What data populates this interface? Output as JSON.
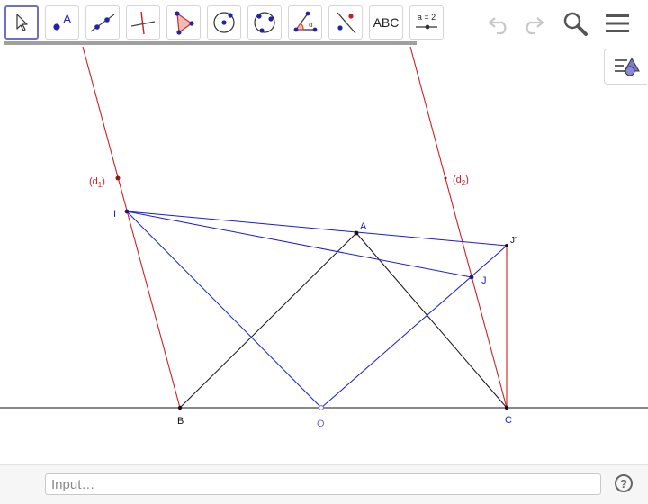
{
  "toolbar": {
    "tools": [
      {
        "name": "move-tool",
        "icon": "cursor-arrow-icon"
      },
      {
        "name": "point-tool",
        "icon": "point-a-icon",
        "label": "A"
      },
      {
        "name": "line-tool",
        "icon": "line-through-points-icon"
      },
      {
        "name": "perpendicular-line-tool",
        "icon": "perpendicular-line-icon"
      },
      {
        "name": "polygon-tool",
        "icon": "triangle-polygon-icon"
      },
      {
        "name": "circle-center-point-tool",
        "icon": "circle-center-icon"
      },
      {
        "name": "circle-three-points-tool",
        "icon": "circle-three-points-icon"
      },
      {
        "name": "angle-tool",
        "icon": "angle-alpha-icon",
        "label": "α"
      },
      {
        "name": "reflect-line-tool",
        "icon": "reflect-line-icon"
      },
      {
        "name": "text-tool",
        "icon": "abc-text-icon",
        "label": "ABC"
      },
      {
        "name": "slider-tool",
        "icon": "slider-icon",
        "label": "a = 2"
      }
    ],
    "undo_icon": "undo-icon",
    "redo_icon": "redo-icon",
    "search_icon": "search-icon",
    "menu_icon": "hamburger-menu-icon"
  },
  "algebra_toggle_icon": "algebra-view-icon",
  "colors": {
    "red": "#d02020",
    "blue": "#1a1ad6",
    "black": "#111111",
    "accent": "#6f6fc8"
  },
  "construction": {
    "labels": {
      "d1": "(d",
      "d1_sub": "1",
      "d1_close": ")",
      "d2": "(d",
      "d2_sub": "2",
      "d2_close": ")",
      "I": "I",
      "A": "A",
      "J_prime": "J'",
      "J": "J",
      "B": "B",
      "O": "O",
      "C": "C"
    }
  },
  "input": {
    "placeholder": "Input…",
    "value": "",
    "help_label": "?"
  }
}
